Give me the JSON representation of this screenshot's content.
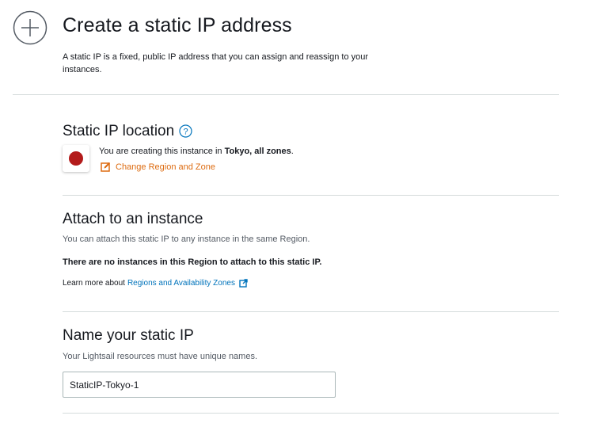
{
  "header": {
    "title": "Create a static IP address",
    "description": "A static IP is a fixed, public IP address that you can assign and reassign to your instances."
  },
  "location_section": {
    "title": "Static IP location",
    "text_prefix": "You are creating this instance in ",
    "region": "Tokyo, all zones",
    "text_suffix": ".",
    "change_link": "Change Region and Zone",
    "flag_color": "#b31b1b",
    "accent_color": "#dd6b10"
  },
  "attach_section": {
    "title": "Attach to an instance",
    "description": "You can attach this static IP to any instance in the same Region.",
    "notice": "There are no instances in this Region to attach to this static IP.",
    "learn_prefix": "Learn more about",
    "learn_link": "Regions and Availability Zones",
    "link_color": "#0073bb"
  },
  "name_section": {
    "title": "Name your static IP",
    "description": "Your Lightsail resources must have unique names.",
    "input_value": "StaticIP-Tokyo-1"
  }
}
